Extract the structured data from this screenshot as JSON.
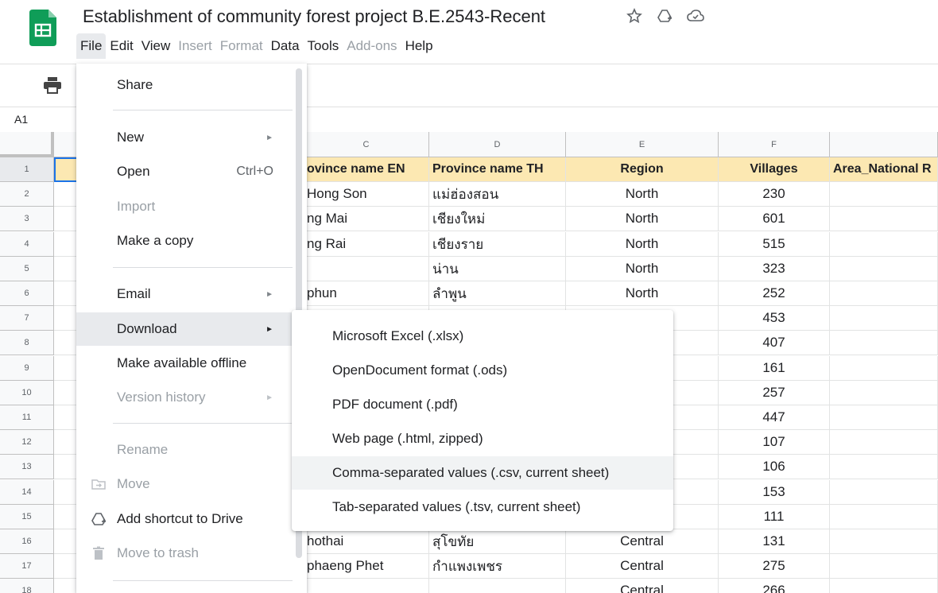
{
  "app": {
    "doc_title": "Establishment of community forest project B.E.2543-Recent",
    "brand_color": "#0f9d58"
  },
  "menubar": [
    {
      "label": "File",
      "disabled": false
    },
    {
      "label": "Edit",
      "disabled": false
    },
    {
      "label": "View",
      "disabled": false
    },
    {
      "label": "Insert",
      "disabled": true
    },
    {
      "label": "Format",
      "disabled": true
    },
    {
      "label": "Data",
      "disabled": false
    },
    {
      "label": "Tools",
      "disabled": false
    },
    {
      "label": "Add-ons",
      "disabled": true
    },
    {
      "label": "Help",
      "disabled": false
    }
  ],
  "namebox": "A1",
  "sheet": {
    "columns": [
      "C",
      "D",
      "E",
      "F"
    ],
    "header_row": {
      "c": "ovince name EN",
      "d": "Province name TH",
      "e": "Region",
      "f": "Villages",
      "g": "Area_National R"
    },
    "row_numbers": [
      "1",
      "2",
      "3",
      "4",
      "5",
      "6",
      "7",
      "8",
      "9",
      "10",
      "11",
      "12",
      "13",
      "14",
      "15",
      "16",
      "17",
      "18"
    ],
    "rows": [
      {
        "c": " Hong Son",
        "d": "แม่ฮ่องสอน",
        "e": "North",
        "f": "230"
      },
      {
        "c": "ng Mai",
        "d": "เชียงใหม่",
        "e": "North",
        "f": "601"
      },
      {
        "c": "ng Rai",
        "d": "เชียงราย",
        "e": "North",
        "f": "515"
      },
      {
        "c": "",
        "d": "น่าน",
        "e": "North",
        "f": "323"
      },
      {
        "c": "phun",
        "d": "ลำพูน",
        "e": "North",
        "f": "252"
      },
      {
        "c": "",
        "d": "",
        "e": "",
        "f": "453"
      },
      {
        "c": "",
        "d": "",
        "e": "",
        "f": "407"
      },
      {
        "c": "",
        "d": "",
        "e": "",
        "f": "161"
      },
      {
        "c": "",
        "d": "",
        "e": "",
        "f": "257"
      },
      {
        "c": "",
        "d": "",
        "e": "",
        "f": "447"
      },
      {
        "c": "",
        "d": "",
        "e": "",
        "f": "107"
      },
      {
        "c": "",
        "d": "",
        "e": "",
        "f": "106"
      },
      {
        "c": "",
        "d": "",
        "e": "",
        "f": "153"
      },
      {
        "c": "",
        "d": "",
        "e": "",
        "f": "111"
      },
      {
        "c": "hothai",
        "d": "สุโขทัย",
        "e": "Central",
        "f": "131"
      },
      {
        "c": "phaeng Phet",
        "d": "กำแพงเพชร",
        "e": "Central",
        "f": "275"
      },
      {
        "c": "",
        "d": "",
        "e": "Central",
        "f": "266"
      }
    ]
  },
  "file_menu": {
    "items": [
      {
        "label": "Share",
        "shortcut": "",
        "submenu": false,
        "disabled": false,
        "icon": ""
      },
      {
        "label": "New",
        "shortcut": "",
        "submenu": true,
        "disabled": false,
        "icon": ""
      },
      {
        "label": "Open",
        "shortcut": "Ctrl+O",
        "submenu": false,
        "disabled": false,
        "icon": ""
      },
      {
        "label": "Import",
        "shortcut": "",
        "submenu": false,
        "disabled": true,
        "icon": ""
      },
      {
        "label": "Make a copy",
        "shortcut": "",
        "submenu": false,
        "disabled": false,
        "icon": ""
      },
      {
        "label": "Email",
        "shortcut": "",
        "submenu": true,
        "disabled": false,
        "icon": ""
      },
      {
        "label": "Download",
        "shortcut": "",
        "submenu": true,
        "disabled": false,
        "icon": "",
        "active": true
      },
      {
        "label": "Make available offline",
        "shortcut": "",
        "submenu": false,
        "disabled": false,
        "icon": ""
      },
      {
        "label": "Version history",
        "shortcut": "",
        "submenu": true,
        "disabled": true,
        "icon": ""
      },
      {
        "label": "Rename",
        "shortcut": "",
        "submenu": false,
        "disabled": true,
        "icon": ""
      },
      {
        "label": "Move",
        "shortcut": "",
        "submenu": false,
        "disabled": true,
        "icon": "folder-move-icon"
      },
      {
        "label": "Add shortcut to Drive",
        "shortcut": "",
        "submenu": false,
        "disabled": false,
        "icon": "drive-shortcut-icon"
      },
      {
        "label": "Move to trash",
        "shortcut": "",
        "submenu": false,
        "disabled": true,
        "icon": "trash-icon"
      }
    ]
  },
  "download_menu": {
    "items": [
      {
        "label": "Microsoft Excel (.xlsx)"
      },
      {
        "label": "OpenDocument format (.ods)"
      },
      {
        "label": "PDF document (.pdf)"
      },
      {
        "label": "Web page (.html, zipped)"
      },
      {
        "label": "Comma-separated values (.csv, current sheet)",
        "hover": true
      },
      {
        "label": "Tab-separated values (.tsv, current sheet)"
      }
    ]
  }
}
